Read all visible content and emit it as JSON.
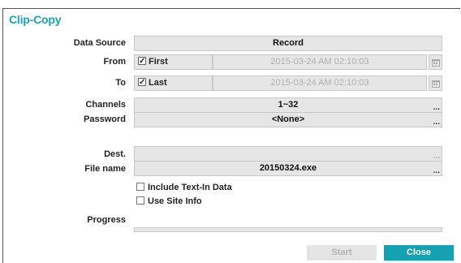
{
  "dialog": {
    "title": "Clip-Copy"
  },
  "fields": {
    "data_source": {
      "label": "Data Source",
      "value": "Record"
    },
    "from": {
      "label": "From",
      "checkbox_label": "First",
      "checked": true,
      "datetime": "2015-03-24  AM 02:10:03"
    },
    "to": {
      "label": "To",
      "checkbox_label": "Last",
      "checked": true,
      "datetime": "2015-03-24  AM 02:10:03"
    },
    "channels": {
      "label": "Channels",
      "value": "1~32",
      "ellipsis": "..."
    },
    "password": {
      "label": "Password",
      "value": "<None>",
      "ellipsis": "..."
    },
    "dest": {
      "label": "Dest.",
      "value": "",
      "ellipsis": "..."
    },
    "file_name": {
      "label": "File name",
      "value": "20150324.exe",
      "ellipsis": "..."
    }
  },
  "options": {
    "include_text_in": {
      "label": "Include Text-In Data",
      "checked": false
    },
    "use_site_info": {
      "label": "Use Site Info",
      "checked": false
    }
  },
  "progress": {
    "label": "Progress",
    "value": 0
  },
  "buttons": {
    "start": "Start",
    "close": "Close"
  },
  "colors": {
    "accent": "#16a1b3",
    "field_bg": "#e6e6e6",
    "disabled_text": "#b0b0b0"
  },
  "icons": {
    "calendar": "calendar-icon"
  }
}
